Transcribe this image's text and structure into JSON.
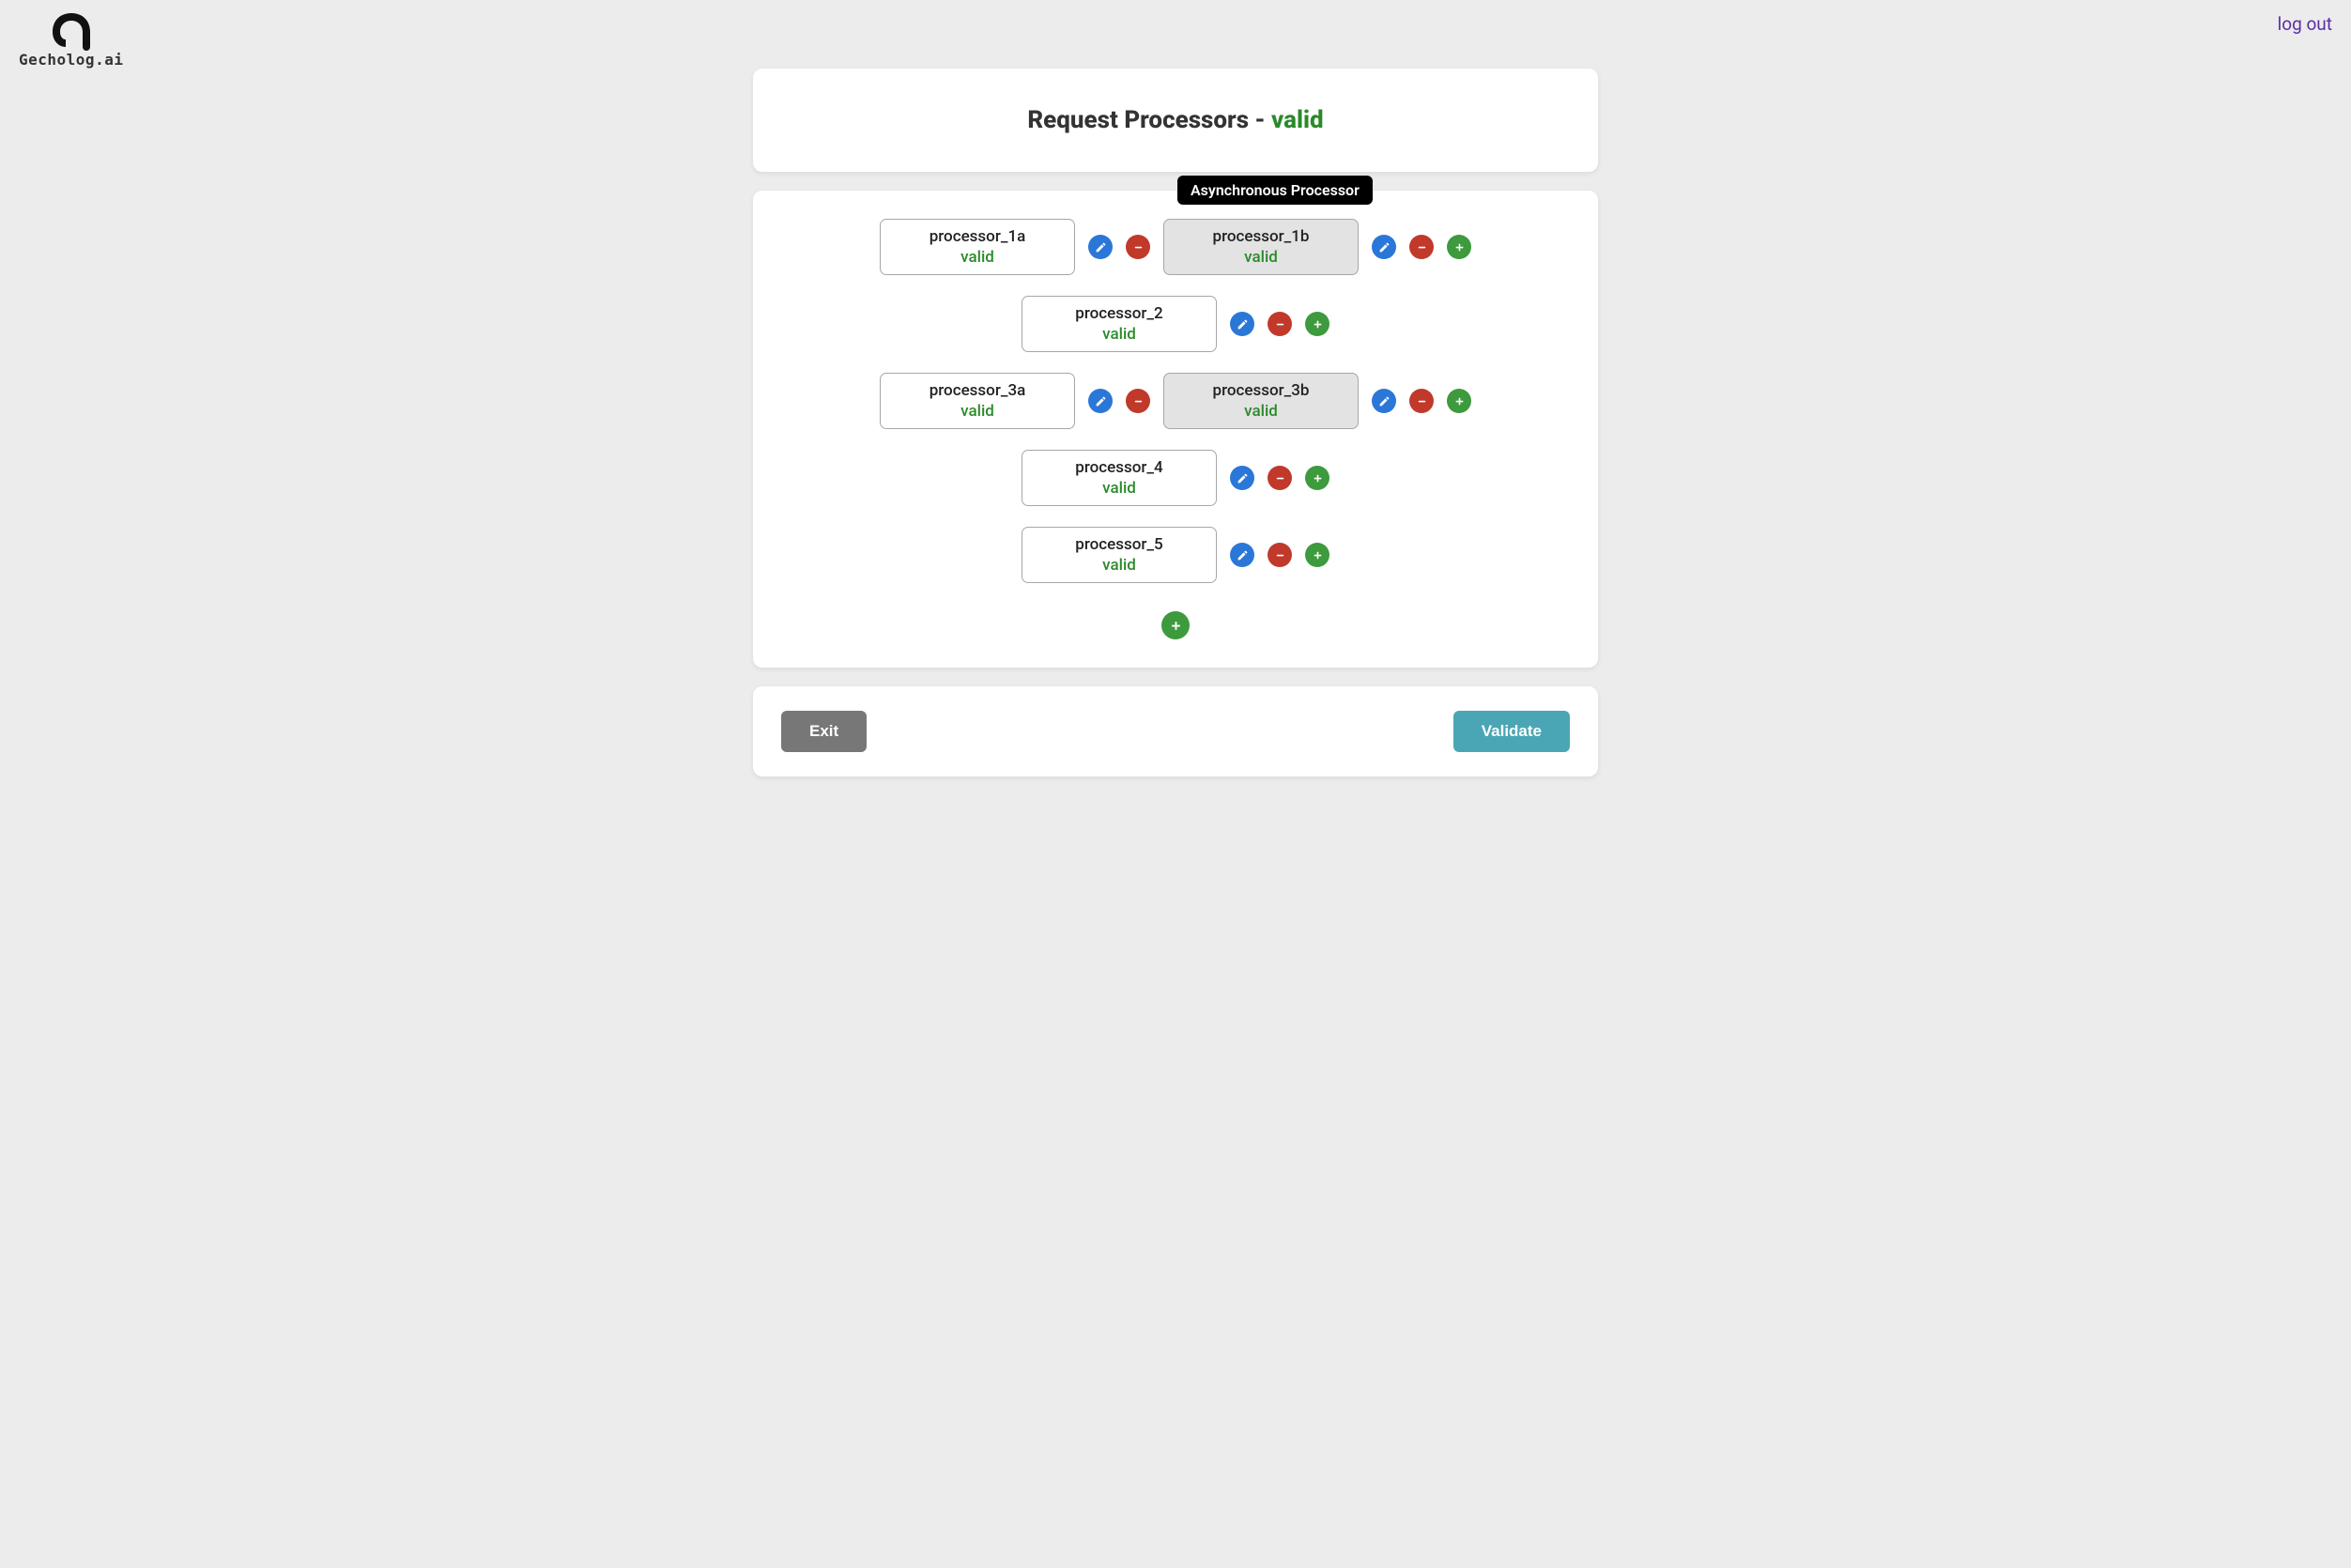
{
  "brand": "Gecholog.ai",
  "topbar": {
    "logout": "log out"
  },
  "header": {
    "title_prefix": "Request Processors - ",
    "status": "valid"
  },
  "tooltip": "Asynchronous Processor",
  "status_label": "valid",
  "rows": [
    {
      "type": "pair",
      "a": {
        "name": "processor_1a",
        "status": "valid"
      },
      "b": {
        "name": "processor_1b",
        "status": "valid"
      }
    },
    {
      "type": "single",
      "a": {
        "name": "processor_2",
        "status": "valid"
      }
    },
    {
      "type": "pair",
      "a": {
        "name": "processor_3a",
        "status": "valid"
      },
      "b": {
        "name": "processor_3b",
        "status": "valid"
      }
    },
    {
      "type": "single",
      "a": {
        "name": "processor_4",
        "status": "valid"
      }
    },
    {
      "type": "single",
      "a": {
        "name": "processor_5",
        "status": "valid"
      }
    }
  ],
  "footer": {
    "exit": "Exit",
    "validate": "Validate"
  }
}
